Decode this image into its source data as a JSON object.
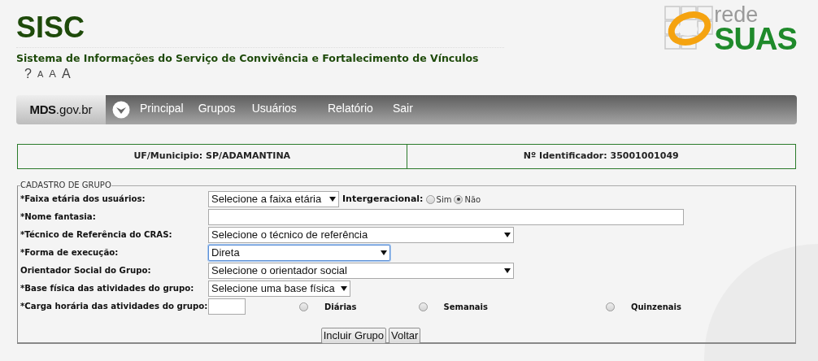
{
  "header": {
    "title": "SISC",
    "subtitle": "Sistema de Informações do Serviço de Convivência e Fortalecimento de Vínculos",
    "font_controls": [
      "?",
      "A",
      "A",
      "A"
    ],
    "logo": {
      "top": "rede",
      "bottom": "SUAS"
    }
  },
  "nav": {
    "brand_bold": "MDS",
    "brand_rest": ".gov.br",
    "items": [
      "Principal",
      "Grupos",
      "Usuários",
      "Relatório",
      "Sair"
    ]
  },
  "info": [
    "UF/Municipio: SP/ADAMANTINA",
    "Nº Identificador: 35001001049"
  ],
  "form": {
    "legend": "CADASTRO DE GRUPO",
    "fields": [
      {
        "kind": "select",
        "label": "*Faixa etária dos usuários:",
        "value": "Selecione a faixa etária",
        "focused": false,
        "extra": {
          "label": "Intergeracional:",
          "options": [
            {
              "label": "Sim",
              "selected": false
            },
            {
              "label": "Não",
              "selected": true
            }
          ]
        }
      },
      {
        "kind": "text",
        "label": "*Nome fantasia:"
      },
      {
        "kind": "select",
        "label": "*Técnico de Referência do CRAS:",
        "value": "Selecione o técnico de referência",
        "focused": false
      },
      {
        "kind": "select",
        "label": "*Forma de execução:",
        "value": "Direta",
        "focused": true
      },
      {
        "kind": "select",
        "label": "Orientador Social do Grupo:",
        "value": "Selecione o orientador social",
        "focused": false
      },
      {
        "kind": "select",
        "label": "*Base física das atividades do grupo:",
        "value": "Selecione uma base física",
        "focused": false
      },
      {
        "kind": "hours",
        "label": "*Carga horária das atividades do grupo:",
        "options": [
          {
            "label": "Diárias",
            "selected": false
          },
          {
            "label": "Semanais",
            "selected": false
          },
          {
            "label": "Quinzenais",
            "selected": false
          }
        ]
      }
    ],
    "buttons": [
      "Incluir Grupo",
      "Voltar"
    ]
  }
}
